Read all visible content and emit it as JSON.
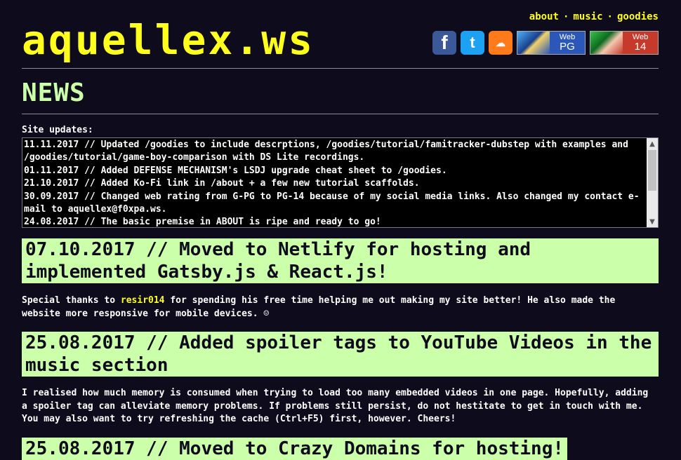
{
  "header": {
    "site_title": "aquellex.ws",
    "nav": {
      "about": "about",
      "music": "music",
      "goodies": "goodies",
      "separator": "·"
    },
    "badges": {
      "facebook_glyph": "f",
      "twitter_glyph": "t",
      "soundcloud_glyph": "☁",
      "web_pg": {
        "small": "Web",
        "big": "PG"
      },
      "web_14": {
        "small": "Web",
        "big": "14"
      }
    }
  },
  "news": {
    "heading": "NEWS",
    "updates_label": "Site updates:",
    "updates": [
      "11.11.2017 // Updated /goodies to include descrptions, /goodies/tutorial/famitracker-dubstep with examples and /goodies/tutorial/game-boy-comparison with DS Lite recordings.",
      "01.11.2017 // Added DEFENSE MECHANISM's LSDJ upgrade cheat sheet to /goodies.",
      "21.10.2017 // Added Ko-Fi link in /about + a few new tutorial scaffolds.",
      "30.09.2017 // Changed web rating from G-PG to PG-14 because of my social media links. Also changed my contact e-mail to aquellex@f0xpa.ws.",
      "24.08.2017 // The basic premise in ABOUT is ripe and ready to go!"
    ],
    "posts": [
      {
        "title": "07.10.2017 // Moved to Netlify for hosting and implemented Gatsby.js & React.js!",
        "body_before": "Special thanks to ",
        "body_link": "resir014",
        "body_after": " for spending his free time helping me out making my site better! He also made the website more responsive for mobile devices. ☺"
      },
      {
        "title": "25.08.2017 // Added spoiler tags to YouTube Videos in the music section",
        "body": "I realised how much memory is consumed when trying to load too many embedded videos in one page. Hopefully, adding a spoiler tag can alleviate memory problems. If problems still persist, do not hestitate to get in touch with me. You may also want to try refreshing the cache (Ctrl+F5) first, however. Cheers!"
      },
      {
        "title": "25.08.2017 // Moved to Crazy Domains for hosting!"
      }
    ]
  },
  "colors": {
    "background": "#0d0b1c",
    "accent_yellow": "#ffff1e",
    "accent_green": "#ccffaa"
  }
}
